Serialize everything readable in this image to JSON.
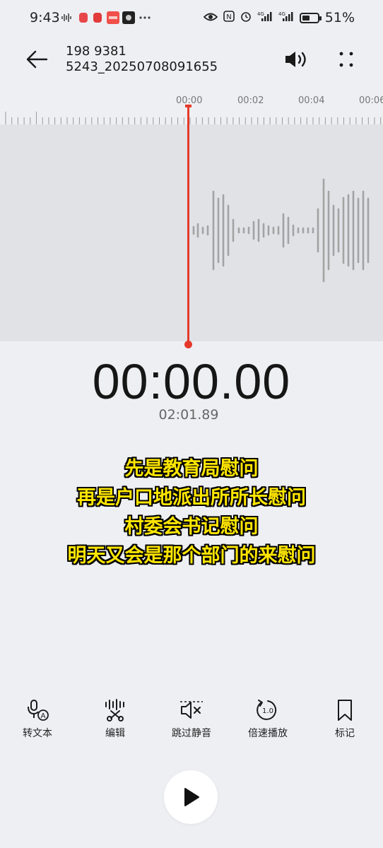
{
  "status_bar": {
    "time": "9:43",
    "battery": "51%",
    "battery_level": 0.51,
    "icons": [
      "voice-wave-icon",
      "app-notification-icon",
      "app-notification-icon",
      "app-notification-icon",
      "app-notification-icon",
      "more-dots-icon",
      "eye-icon",
      "nfc-icon",
      "alarm-icon",
      "signal-4g-icon",
      "signal-4g-icon",
      "battery-icon"
    ]
  },
  "header": {
    "title_line1": "198 9381",
    "title_line2": "5243_20250708091655",
    "back_icon": "arrow-left-icon",
    "speaker_icon": "speaker-icon",
    "more_icon": "more-vertical-icon"
  },
  "timeline": {
    "labels": [
      "00:00",
      "00:02",
      "00:04",
      "00:06"
    ]
  },
  "player": {
    "elapsed": "00:00.00",
    "duration": "02:01.89",
    "accent_color": "#e53a2a"
  },
  "subtitles": [
    "先是教育局慰问",
    "再是户口地派出所所长慰问",
    "村委会书记慰问",
    "明天又会是那个部门的来慰问"
  ],
  "tools": [
    {
      "label": "转文本",
      "icon": "speech-to-text-icon"
    },
    {
      "label": "编辑",
      "icon": "edit-scissors-icon"
    },
    {
      "label": "跳过静音",
      "icon": "skip-silence-icon"
    },
    {
      "label": "倍速播放",
      "icon": "playback-speed-icon",
      "badge": "1.0"
    },
    {
      "label": "标记",
      "icon": "bookmark-icon"
    }
  ],
  "play_icon": "play-icon"
}
